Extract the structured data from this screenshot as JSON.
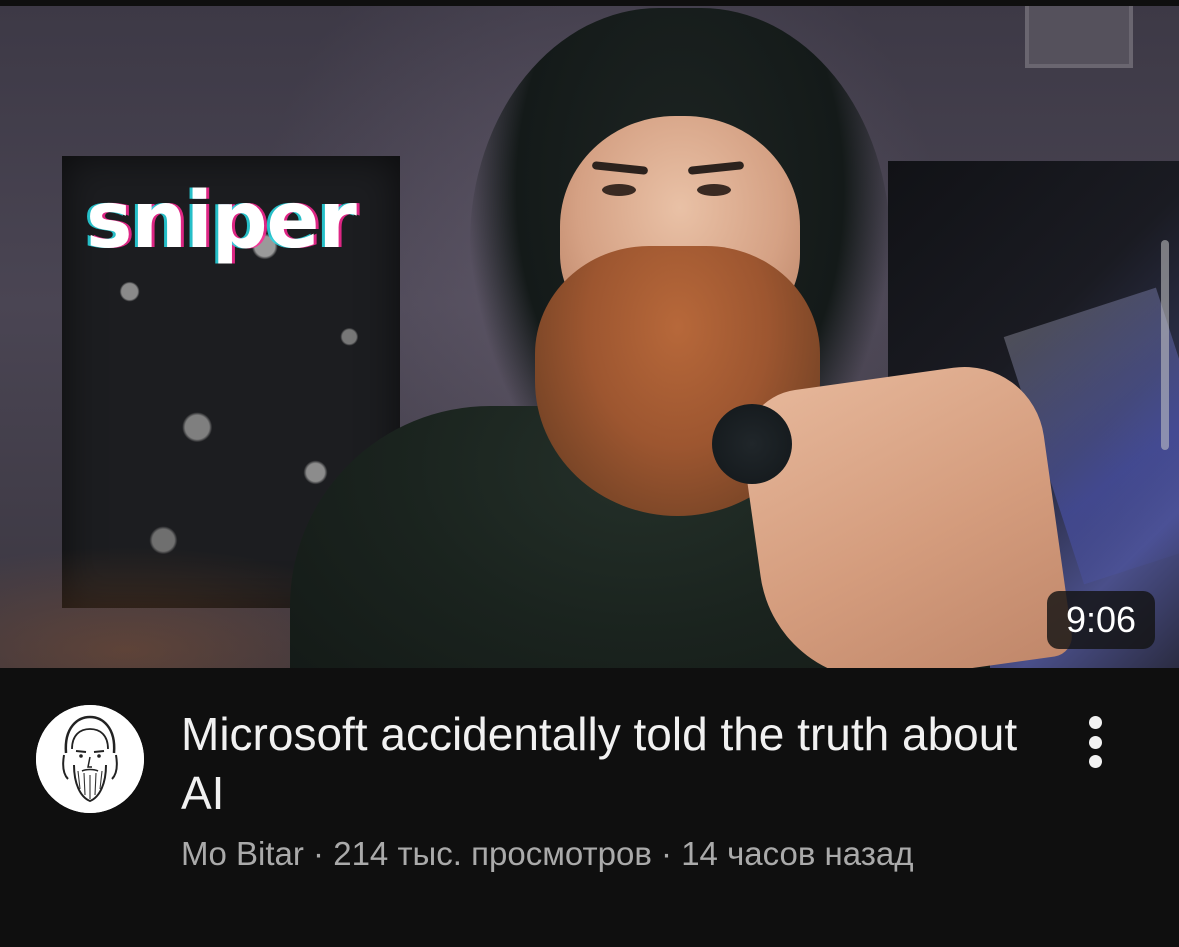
{
  "video": {
    "thumbnail_overlay_text": "sniper",
    "duration": "9:06",
    "title": "Microsoft accidentally told the truth about AI",
    "channel": "Mo Bitar",
    "separator": "·",
    "views": "214 тыс. просмотров",
    "age": "14 часов назад"
  },
  "icons": {
    "more": "vertical-ellipsis-icon",
    "avatar": "bearded-man-sketch"
  },
  "colors": {
    "background": "#0f0f0f",
    "title_text": "#f1f1f1",
    "meta_text": "#aaaaaa",
    "duration_badge_bg": "#141414"
  }
}
